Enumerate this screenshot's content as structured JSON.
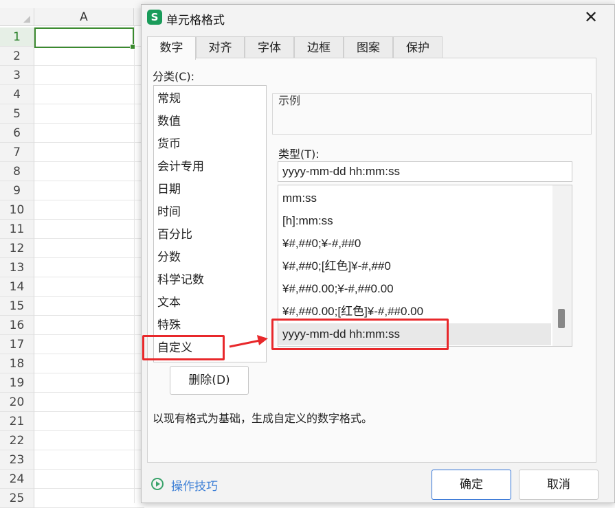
{
  "sheet": {
    "column_header": "A",
    "row_numbers": [
      "1",
      "2",
      "3",
      "4",
      "5",
      "6",
      "7",
      "8",
      "9",
      "10",
      "11",
      "12",
      "13",
      "14",
      "15",
      "16",
      "17",
      "18",
      "19",
      "20",
      "21",
      "22",
      "23",
      "24",
      "25"
    ]
  },
  "dialog": {
    "app_icon_letter": "S",
    "title": "单元格格式",
    "close_glyph": "✕",
    "tabs": [
      "数字",
      "对齐",
      "字体",
      "边框",
      "图案",
      "保护"
    ],
    "category_label": "分类(C):",
    "categories": [
      "常规",
      "数值",
      "货币",
      "会计专用",
      "日期",
      "时间",
      "百分比",
      "分数",
      "科学记数",
      "文本",
      "特殊",
      "自定义"
    ],
    "selected_category": "自定义",
    "example_label": "示例",
    "type_label": "类型(T):",
    "type_input_value": "yyyy-mm-dd hh:mm:ss",
    "type_list": [
      "mm:ss",
      "[h]:mm:ss",
      "¥#,##0;¥-#,##0",
      "¥#,##0;[红色]¥-#,##0",
      "¥#,##0.00;¥-#,##0.00",
      "¥#,##0.00;[红色]¥-#,##0.00",
      "yyyy-mm-dd hh:mm:ss"
    ],
    "selected_type": "yyyy-mm-dd hh:mm:ss",
    "delete_button": "删除(D)",
    "description": "以现有格式为基础，生成自定义的数字格式。",
    "tips_link": "操作技巧",
    "ok_button": "确定",
    "cancel_button": "取消"
  },
  "colors": {
    "annotation_red": "#e8282b",
    "active_cell_green": "#3a8a2e",
    "link_blue": "#3d7fd6",
    "ok_border_blue": "#2a6ed4"
  }
}
